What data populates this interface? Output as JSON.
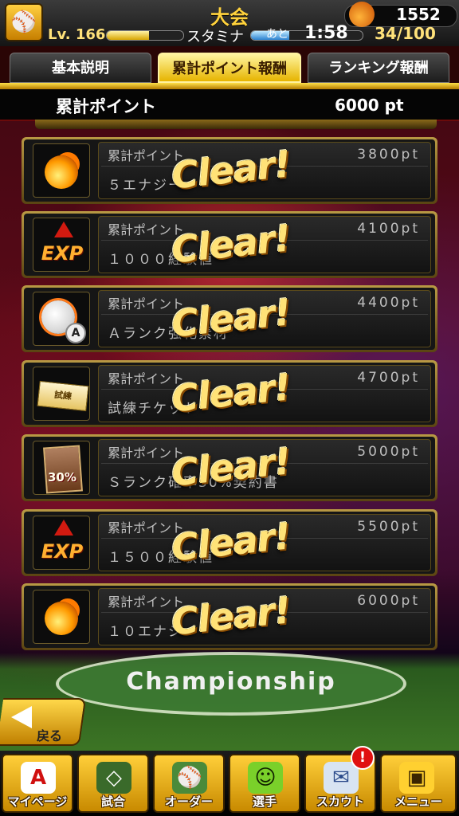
{
  "header": {
    "title": "大会",
    "coins": "1552",
    "level_label": "Lv.",
    "level": "166",
    "level_progress": 0.55,
    "stamina_label": "スタミナ",
    "stamina_remaining_label": "あと",
    "stamina_timer": "1:58",
    "stamina_value": "34/100",
    "stamina_progress": 0.34
  },
  "tabs": [
    {
      "label": "基本説明",
      "active": false
    },
    {
      "label": "累計ポイント報酬",
      "active": true
    },
    {
      "label": "ランキング報酬",
      "active": false
    }
  ],
  "points": {
    "label": "累計ポイント",
    "value": "6000 pt"
  },
  "rewards": [
    {
      "label": "累計ポイント",
      "points": "3800pt",
      "item": "５エナジー",
      "icon": "fireball-icon",
      "status": "Clear!"
    },
    {
      "label": "累計ポイント",
      "points": "4100pt",
      "item": "１０００経験値",
      "icon": "exp-icon",
      "status": "Clear!"
    },
    {
      "label": "累計ポイント",
      "points": "4400pt",
      "item": "Ａランク強化素材",
      "icon": "baseball-a-rank-icon",
      "status": "Clear!"
    },
    {
      "label": "累計ポイント",
      "points": "4700pt",
      "item": "試練チケット",
      "icon": "ticket-icon",
      "status": "Clear!"
    },
    {
      "label": "累計ポイント",
      "points": "5000pt",
      "item": "Ｓランク確率30%契約書",
      "icon": "contract-icon",
      "status": "Clear!"
    },
    {
      "label": "累計ポイント",
      "points": "5500pt",
      "item": "１５００経験値",
      "icon": "exp-icon",
      "status": "Clear!"
    },
    {
      "label": "累計ポイント",
      "points": "6000pt",
      "item": "１０エナジー",
      "icon": "fireball-icon",
      "status": "Clear!"
    }
  ],
  "contract_percent": "30%",
  "ticket_text": "試練",
  "rank_badge": "A",
  "exp_text": "EXP",
  "field_text": "Championship",
  "back_button": {
    "label": "戻る"
  },
  "nav": [
    {
      "label": "マイページ",
      "icon": "mypage-icon",
      "glyph": "A"
    },
    {
      "label": "試合",
      "icon": "stadium-icon",
      "glyph": "◇"
    },
    {
      "label": "オーダー",
      "icon": "order-icon",
      "glyph": "⚾"
    },
    {
      "label": "選手",
      "icon": "player-icon",
      "glyph": "☺"
    },
    {
      "label": "スカウト",
      "icon": "scout-icon",
      "glyph": "✉",
      "badge": "!"
    },
    {
      "label": "メニュー",
      "icon": "menu-icon",
      "glyph": "▣"
    }
  ],
  "colors": {
    "accent": "#ffd23c",
    "clear": "#ffe277",
    "badge": "#e01010"
  }
}
